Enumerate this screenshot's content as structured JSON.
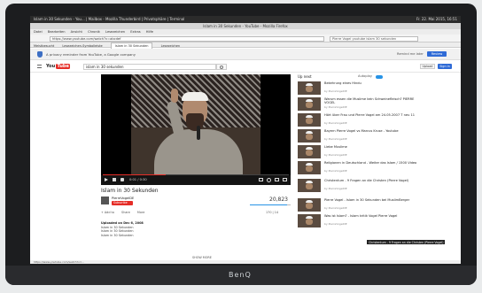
{
  "os": {
    "left": "Islam in 30 Sekunden - You... | Mailbox - Mozilla Thunderbird | Privatsphäre | Terminal",
    "clock": "Fr. 22. Mai 2015, 16:51"
  },
  "browser": {
    "window_title": "Islam in 30 Sekunden - YouTube - Mozilla Firefox",
    "menu": [
      "Datei",
      "Bearbeiten",
      "Ansicht",
      "Chronik",
      "Lesezeichen",
      "Extras",
      "Hilfe"
    ],
    "url": "https://www.youtube.com/watch?v=abcdef",
    "search": "Pierre Vogel youtube islam 30 sekunden",
    "bookmarks": [
      "Meistbesucht",
      "Lesezeichen-Symbolleiste"
    ],
    "tabs": [
      "Islam in 30 Sekunden",
      "Lesezeichen"
    ],
    "status": "https://www.youtube.com/watch?v=..."
  },
  "notice": {
    "text": "A privacy reminder from YouTube, a Google company",
    "remind_later": "Remind me later",
    "review": "Review"
  },
  "youtube": {
    "logo_you": "You",
    "logo_tube": "Tube",
    "search_value": "islam in 30 sekunden",
    "upload": "Upload",
    "signin": "Sign in"
  },
  "player": {
    "time": "0:01 / 0:30",
    "progress": 0.34
  },
  "video": {
    "title": "Islam in 30 Sekunden",
    "channel": "PierreVogelDE",
    "subscribe": "Subscribe",
    "views": "20,823",
    "likes": "170 | 14",
    "like_ratio": 0.92,
    "actions": [
      "+ Add to",
      "Share",
      "More"
    ],
    "published": "Uploaded on Dec 6, 2008",
    "description": [
      "Islam in 30 Sekunden",
      "Islam in 30 Sekunden",
      "Islam in 30 Sekunden"
    ],
    "load_more": "SHOW MORE"
  },
  "sidebar": {
    "up_next": "Up next",
    "autoplay": "Autoplay",
    "items": [
      {
        "title": "Bekehrung eines Hindu",
        "meta": "by PierreVogelDE"
      },
      {
        "title": "Warum essen die Muslime kein Schweinefleisch? PIERRE VOGEL",
        "meta": "by PierreVogelDE"
      },
      {
        "title": "Hört über Frau und Pierre Vogel am 24.05.2007 T neu 11",
        "meta": "by PierreVogelDE"
      },
      {
        "title": "Bayern Pierre Vogel vs Marcus Kruse - Youtube",
        "meta": "by PierreVogelDE"
      },
      {
        "title": "Liebe Muslime",
        "meta": "by PierreVogelDE"
      },
      {
        "title": "Religionen in Deutschland - Weiter das Islam / 1500 Video",
        "meta": "by PierreVogelDE"
      },
      {
        "title": "Christentum - 9 Fragen an die Christen (Pierre Vogel)",
        "meta": "by PierreVogelDE"
      },
      {
        "title": "Pierre Vogel - Islam in 30 Sekunden bei MuslimBerger",
        "meta": "by PierreVogelDE"
      },
      {
        "title": "Was ist Islam? - Islam kritik Vogel Pierre Vogel",
        "meta": "by PierreVogelDE"
      }
    ],
    "tooltip": "Christentum - 9 Fragen an die Christen (Pierre Vogel)"
  },
  "monitor": {
    "brand": "BenQ"
  },
  "colors": {
    "yt_red": "#e52d27",
    "accent_blue": "#2f6bd6"
  }
}
